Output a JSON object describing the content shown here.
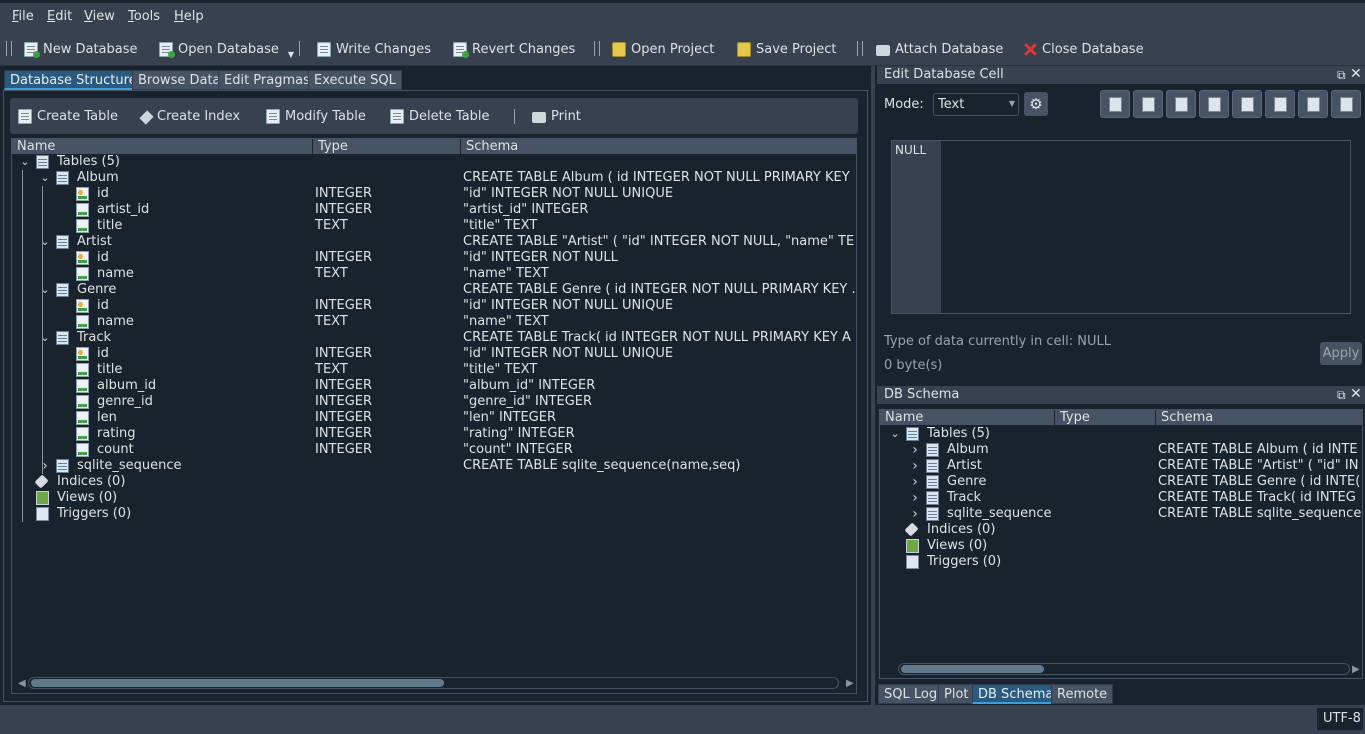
{
  "menu": [
    "File",
    "Edit",
    "View",
    "Tools",
    "Help"
  ],
  "toolbar": {
    "new_db": "New Database",
    "open_db": "Open Database",
    "write": "Write Changes",
    "revert": "Revert Changes",
    "open_project": "Open Project",
    "save_project": "Save Project",
    "attach": "Attach Database",
    "close": "Close Database"
  },
  "tabs": [
    "Database Structure",
    "Browse Data",
    "Edit Pragmas",
    "Execute SQL"
  ],
  "struct_toolbar": {
    "create_table": "Create Table",
    "create_index": "Create Index",
    "modify_table": "Modify Table",
    "delete_table": "Delete Table",
    "print": "Print"
  },
  "tree": {
    "headers": [
      "Name",
      "Type",
      "Schema"
    ],
    "rows": [
      {
        "name": "Tables (5)",
        "type": "",
        "schema": "",
        "kind": "table",
        "level": 0,
        "expand": "down"
      },
      {
        "name": "Album",
        "type": "",
        "schema": "CREATE TABLE Album ( id INTEGER NOT NULL PRIMARY KEY",
        "kind": "table",
        "level": 1,
        "expand": "down"
      },
      {
        "name": "id",
        "type": "INTEGER",
        "schema": "\"id\" INTEGER NOT NULL UNIQUE",
        "kind": "key",
        "level": 2
      },
      {
        "name": "artist_id",
        "type": "INTEGER",
        "schema": "\"artist_id\" INTEGER",
        "kind": "field",
        "level": 2
      },
      {
        "name": "title",
        "type": "TEXT",
        "schema": "\"title\" TEXT",
        "kind": "field",
        "level": 2
      },
      {
        "name": "Artist",
        "type": "",
        "schema": "CREATE TABLE \"Artist\" ( \"id\" INTEGER NOT NULL, \"name\" TE",
        "kind": "table",
        "level": 1,
        "expand": "down"
      },
      {
        "name": "id",
        "type": "INTEGER",
        "schema": "\"id\" INTEGER NOT NULL",
        "kind": "key",
        "level": 2
      },
      {
        "name": "name",
        "type": "TEXT",
        "schema": "\"name\" TEXT",
        "kind": "field",
        "level": 2
      },
      {
        "name": "Genre",
        "type": "",
        "schema": "CREATE TABLE Genre ( id INTEGER NOT NULL PRIMARY KEY .",
        "kind": "table",
        "level": 1,
        "expand": "down"
      },
      {
        "name": "id",
        "type": "INTEGER",
        "schema": "\"id\" INTEGER NOT NULL UNIQUE",
        "kind": "key",
        "level": 2
      },
      {
        "name": "name",
        "type": "TEXT",
        "schema": "\"name\" TEXT",
        "kind": "field",
        "level": 2
      },
      {
        "name": "Track",
        "type": "",
        "schema": "CREATE TABLE Track( id INTEGER NOT NULL PRIMARY KEY A",
        "kind": "table",
        "level": 1,
        "expand": "down"
      },
      {
        "name": "id",
        "type": "INTEGER",
        "schema": "\"id\" INTEGER NOT NULL UNIQUE",
        "kind": "key",
        "level": 2
      },
      {
        "name": "title",
        "type": "TEXT",
        "schema": "\"title\" TEXT",
        "kind": "field",
        "level": 2
      },
      {
        "name": "album_id",
        "type": "INTEGER",
        "schema": "\"album_id\" INTEGER",
        "kind": "field",
        "level": 2
      },
      {
        "name": "genre_id",
        "type": "INTEGER",
        "schema": "\"genre_id\" INTEGER",
        "kind": "field",
        "level": 2
      },
      {
        "name": "len",
        "type": "INTEGER",
        "schema": "\"len\" INTEGER",
        "kind": "field",
        "level": 2
      },
      {
        "name": "rating",
        "type": "INTEGER",
        "schema": "\"rating\" INTEGER",
        "kind": "field",
        "level": 2
      },
      {
        "name": "count",
        "type": "INTEGER",
        "schema": "\"count\" INTEGER",
        "kind": "field",
        "level": 2
      },
      {
        "name": "sqlite_sequence",
        "type": "",
        "schema": "CREATE TABLE sqlite_sequence(name,seq)",
        "kind": "table",
        "level": 1,
        "expand": "right"
      },
      {
        "name": "Indices (0)",
        "type": "",
        "schema": "",
        "kind": "tag",
        "level": 0
      },
      {
        "name": "Views (0)",
        "type": "",
        "schema": "",
        "kind": "view",
        "level": 0
      },
      {
        "name": "Triggers (0)",
        "type": "",
        "schema": "",
        "kind": "trig",
        "level": 0
      }
    ]
  },
  "edit_cell": {
    "title": "Edit Database Cell",
    "mode_label": "Mode:",
    "mode_value": "Text",
    "cell_value": "NULL",
    "type_info": "Type of data currently in cell: NULL",
    "size_info": "0 byte(s)",
    "apply": "Apply"
  },
  "db_schema": {
    "title": "DB Schema",
    "headers": [
      "Name",
      "Type",
      "Schema"
    ],
    "rows": [
      {
        "name": "Tables (5)",
        "schema": "",
        "kind": "table",
        "level": 0,
        "expand": "down"
      },
      {
        "name": "Album",
        "schema": "CREATE TABLE Album ( id INTE",
        "kind": "table",
        "level": 1,
        "expand": "right"
      },
      {
        "name": "Artist",
        "schema": "CREATE TABLE \"Artist\" ( \"id\" IN",
        "kind": "table",
        "level": 1,
        "expand": "right"
      },
      {
        "name": "Genre",
        "schema": "CREATE TABLE Genre ( id INTE(",
        "kind": "table",
        "level": 1,
        "expand": "right"
      },
      {
        "name": "Track",
        "schema": "CREATE TABLE Track( id INTEG",
        "kind": "table",
        "level": 1,
        "expand": "right"
      },
      {
        "name": "sqlite_sequence",
        "schema": "CREATE TABLE sqlite_sequence",
        "kind": "table",
        "level": 1,
        "expand": "right"
      },
      {
        "name": "Indices (0)",
        "schema": "",
        "kind": "tag",
        "level": 0
      },
      {
        "name": "Views (0)",
        "schema": "",
        "kind": "view",
        "level": 0
      },
      {
        "name": "Triggers (0)",
        "schema": "",
        "kind": "trig",
        "level": 0
      }
    ]
  },
  "bottom_tabs": [
    "SQL Log",
    "Plot",
    "DB Schema",
    "Remote"
  ],
  "status": {
    "encoding": "UTF-8"
  }
}
